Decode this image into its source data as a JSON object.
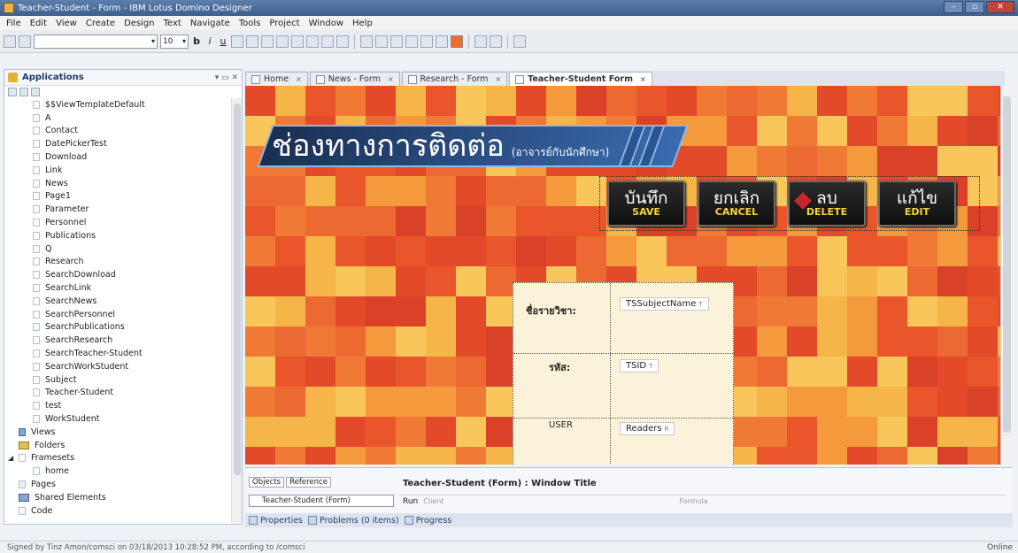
{
  "window": {
    "title": "Teacher-Student - Form - IBM Lotus Domino Designer",
    "buttons": [
      "–",
      "▫",
      "✕"
    ]
  },
  "menu": [
    "File",
    "Edit",
    "View",
    "Create",
    "Design",
    "Text",
    "Navigate",
    "Tools",
    "Project",
    "Window",
    "Help"
  ],
  "toolbar": {
    "font_size": "10",
    "bold": "b",
    "italic": "i",
    "underline": "u"
  },
  "navigator": {
    "title": "Applications",
    "items": [
      "$$ViewTemplateDefault",
      "A",
      "Contact",
      "DatePickerTest",
      "Download",
      "Link",
      "News",
      "Page1",
      "Parameter",
      "Personnel",
      "Publications",
      "Q",
      "Research",
      "SearchDownload",
      "SearchLink",
      "SearchNews",
      "SearchPersonnel",
      "SearchPublications",
      "SearchResearch",
      "SearchTeacher-Student",
      "SearchWorkStudent",
      "Subject",
      "Teacher-Student",
      "test",
      "WorkStudent"
    ],
    "sections": [
      "Views",
      "Folders",
      "Framesets",
      "home",
      "Pages",
      "Shared Elements",
      "Code"
    ]
  },
  "editor_tabs": [
    "Home",
    "News - Form",
    "Research - Form",
    "Teacher-Student  Form"
  ],
  "banner": {
    "title": "ช่องทางการติดต่อ",
    "subtitle": "(อาจารย์กับนักศึกษา)"
  },
  "actions": [
    {
      "th": "บันทึก",
      "en": "SAVE"
    },
    {
      "th": "ยกเลิก",
      "en": "CANCEL"
    },
    {
      "th": "ลบ",
      "en": "DELETE"
    },
    {
      "th": "แก้ไข",
      "en": "EDIT"
    }
  ],
  "form_fields": [
    {
      "label": "ชื่อรายวิชา:",
      "field": "TSSubjectName",
      "type": "T"
    },
    {
      "label": "รหัส:",
      "field": "TSID",
      "type": "T"
    },
    {
      "label": "USER",
      "field": "Readers",
      "type": "R"
    }
  ],
  "properties_panel": {
    "tabs": [
      "Objects",
      "Reference"
    ],
    "object_select": "Teacher-Student (Form)",
    "window_title": "Teacher-Student (Form) : Window Title",
    "run_label": "Run",
    "run_value": "Client",
    "run_type": "Formula"
  },
  "bottom_tabs": [
    "Properties",
    "Problems (0 items)",
    "Progress"
  ],
  "status": {
    "text": "Signed by Tinz Amon/comsci on 03/18/2013 10:28:52 PM, according to /comsci",
    "online": "Online"
  },
  "colors": {
    "canvas_base": "#e1612f",
    "banner_dark": "#1a2f52",
    "button_en_text": "#f5d531",
    "form_bg": "#fbf3d9"
  }
}
